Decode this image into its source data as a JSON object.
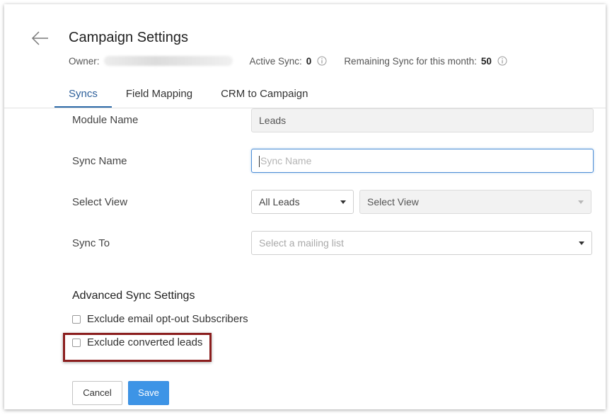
{
  "header": {
    "title": "Campaign Settings",
    "owner_label": "Owner:",
    "active_sync_label": "Active Sync:",
    "active_sync_value": "0",
    "remaining_sync_label": "Remaining Sync for this month:",
    "remaining_sync_value": "50"
  },
  "tabs": [
    {
      "label": "Syncs",
      "active": true
    },
    {
      "label": "Field Mapping",
      "active": false
    },
    {
      "label": "CRM to Campaign",
      "active": false
    }
  ],
  "form": {
    "module_name_label": "Module Name",
    "module_name_value": "Leads",
    "sync_name_label": "Sync Name",
    "sync_name_placeholder": "Sync Name",
    "select_view_label": "Select View",
    "select_view_primary": "All Leads",
    "select_view_secondary": "Select View",
    "sync_to_label": "Sync To",
    "sync_to_placeholder": "Select a mailing list"
  },
  "advanced": {
    "title": "Advanced Sync Settings",
    "options": [
      {
        "label": "Exclude email opt-out Subscribers",
        "checked": false
      },
      {
        "label": "Exclude converted leads",
        "checked": false
      }
    ]
  },
  "buttons": {
    "cancel": "Cancel",
    "save": "Save"
  },
  "colors": {
    "accent": "#2d6aa8",
    "save_button": "#3d94e6",
    "highlight": "#8b1e1e"
  },
  "icons": {
    "back": "arrow-left-icon",
    "info": "info-icon",
    "dropdown": "chevron-down-icon"
  }
}
